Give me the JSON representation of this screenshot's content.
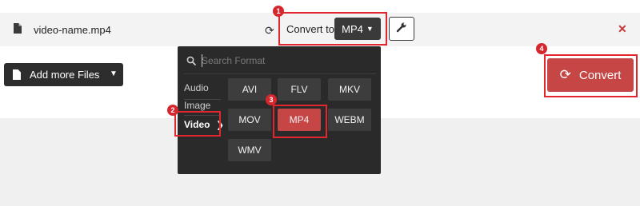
{
  "file": {
    "name": "video-name.mp4"
  },
  "convert_to": {
    "label": "Convert to",
    "selected": "MP4"
  },
  "add_files": {
    "label": "Add more Files"
  },
  "convert_button": {
    "label": "Convert"
  },
  "dropdown": {
    "search_placeholder": "Search Format",
    "categories": [
      "Audio",
      "Image",
      "Video"
    ],
    "active_category": "Video",
    "formats": [
      "AVI",
      "FLV",
      "MKV",
      "MOV",
      "MP4",
      "WEBM",
      "WMV"
    ],
    "selected_format": "MP4"
  },
  "annotations": [
    "1",
    "2",
    "3",
    "4"
  ],
  "colors": {
    "accent": "#c64545",
    "annotation": "#e3252e",
    "dark": "#2a2a2a"
  }
}
